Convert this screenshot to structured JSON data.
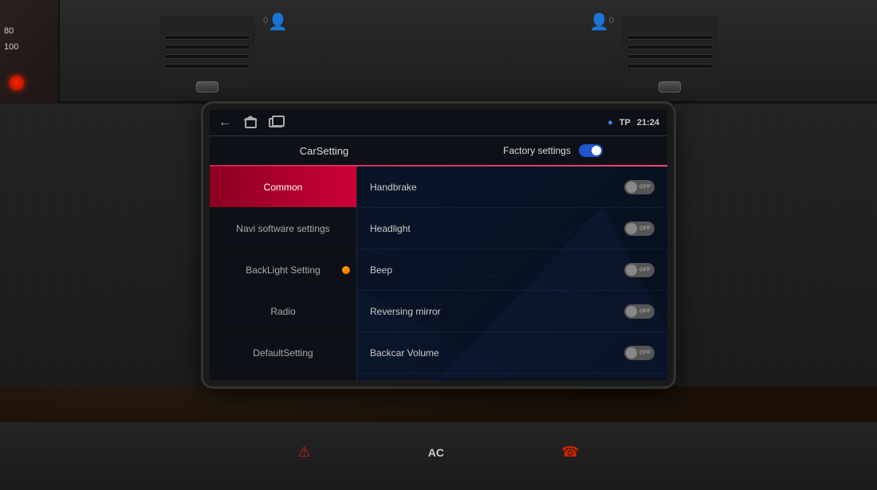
{
  "car": {
    "dash_numbers_left": [
      "80",
      "100"
    ],
    "vent_numbers": [
      "0",
      "0"
    ],
    "seat_icons": [
      "🪑",
      "🪑"
    ]
  },
  "statusbar": {
    "location_icon": "📍",
    "tp_label": "TP",
    "time": "21:24"
  },
  "header": {
    "title": "CarSetting",
    "factory_label": "Factory settings"
  },
  "menu": {
    "items": [
      {
        "id": "common",
        "label": "Common",
        "active": true
      },
      {
        "id": "navi",
        "label": "Navi software settings",
        "active": false
      },
      {
        "id": "backlight",
        "label": "BackLight Setting",
        "active": false
      },
      {
        "id": "radio",
        "label": "Radio",
        "active": false
      },
      {
        "id": "default",
        "label": "DefaultSetting",
        "active": false
      }
    ]
  },
  "settings": {
    "rows": [
      {
        "id": "handbrake",
        "label": "Handbrake",
        "value": "OFF"
      },
      {
        "id": "headlight",
        "label": "Headlight",
        "value": "OFF"
      },
      {
        "id": "beep",
        "label": "Beep",
        "value": "OFF"
      },
      {
        "id": "reversing_mirror",
        "label": "Reversing mirror",
        "value": "OFF"
      },
      {
        "id": "backcar_volume",
        "label": "Backcar Volume",
        "value": "OFF"
      }
    ]
  },
  "bottom": {
    "ac_label": "AC"
  }
}
